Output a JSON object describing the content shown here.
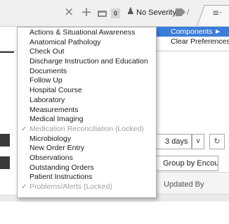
{
  "toolbar": {
    "close_icon": "×",
    "add_icon": "+",
    "count_badge": "0",
    "person_icon": "♟",
    "severity_label": "No Severity",
    "chevron_icon": "∕",
    "menu_icon": "≡·"
  },
  "menu": {
    "items": [
      {
        "label": "Actions & Situational Awareness",
        "checked": false,
        "locked": false
      },
      {
        "label": "Anatomical Pathology",
        "checked": false,
        "locked": false
      },
      {
        "label": "Check Out",
        "checked": false,
        "locked": false
      },
      {
        "label": "Discharge Instruction and Education",
        "checked": false,
        "locked": false
      },
      {
        "label": "Documents",
        "checked": false,
        "locked": false
      },
      {
        "label": "Follow Up",
        "checked": false,
        "locked": false
      },
      {
        "label": "Hospital Course",
        "checked": false,
        "locked": false
      },
      {
        "label": "Laboratory",
        "checked": false,
        "locked": false
      },
      {
        "label": "Measurements",
        "checked": false,
        "locked": false
      },
      {
        "label": "Medical Imaging",
        "checked": false,
        "locked": false
      },
      {
        "label": "Medication Reconciliation (Locked)",
        "checked": true,
        "locked": true
      },
      {
        "label": "Microbiology",
        "checked": false,
        "locked": false
      },
      {
        "label": "New Order Entry",
        "checked": false,
        "locked": false
      },
      {
        "label": "Observations",
        "checked": false,
        "locked": false
      },
      {
        "label": "Outstanding Orders",
        "checked": false,
        "locked": false
      },
      {
        "label": "Patient Instructions",
        "checked": false,
        "locked": false
      },
      {
        "label": "Problems/Alerts (Locked)",
        "checked": true,
        "locked": true
      }
    ],
    "check_glyph": "✓"
  },
  "submenu": {
    "components_label": "Components",
    "arrow_glyph": "▶",
    "clear_label": "Clear Preferences"
  },
  "background": {
    "days_value": "3 days",
    "days_chevron": "∨",
    "refresh_icon": "↻",
    "group_label": "Group by Encounter",
    "updated_header": "Updated By"
  },
  "colors": {
    "highlight": "#3b7ddb",
    "locked_text": "#a0a0a0"
  }
}
